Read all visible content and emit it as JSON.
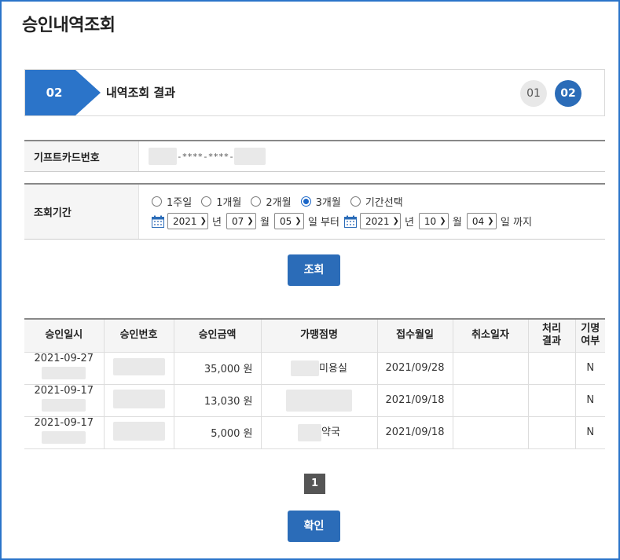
{
  "page": {
    "title": "승인내역조회"
  },
  "step": {
    "current_number": "02",
    "current_title": "내역조회 결과",
    "steps": [
      "01",
      "02"
    ]
  },
  "card_info": {
    "label": "기프트카드번호",
    "masked_value": "-****-****-"
  },
  "period": {
    "label": "조회기간",
    "options": [
      "1주일",
      "1개월",
      "2개월",
      "3개월",
      "기간선택"
    ],
    "selected": "3개월",
    "from": {
      "year": "2021",
      "month": "07",
      "day": "05"
    },
    "to": {
      "year": "2021",
      "month": "10",
      "day": "04"
    },
    "unit_year": "년",
    "unit_month": "월",
    "unit_from": "일 부터",
    "unit_to": "일 까지"
  },
  "buttons": {
    "search": "조회",
    "confirm": "확인"
  },
  "table": {
    "headers": [
      "승인일시",
      "승인번호",
      "승인금액",
      "가맹점명",
      "접수월일",
      "취소일자",
      "처리\n결과",
      "기명\n여부"
    ],
    "rows": [
      {
        "approval_date": "2021-09-27",
        "amount": "35,000 원",
        "merchant_suffix": "미용실",
        "received": "2021/09/28",
        "cancel": "",
        "result": "",
        "named": "N"
      },
      {
        "approval_date": "2021-09-17",
        "amount": "13,030 원",
        "merchant_suffix": "",
        "received": "2021/09/18",
        "cancel": "",
        "result": "",
        "named": "N"
      },
      {
        "approval_date": "2021-09-17",
        "amount": "5,000 원",
        "merchant_suffix": "약국",
        "received": "2021/09/18",
        "cancel": "",
        "result": "",
        "named": "N"
      }
    ]
  },
  "pagination": {
    "current": "1"
  },
  "colors": {
    "accent": "#2b6cb8",
    "frame": "#2b74c9"
  }
}
